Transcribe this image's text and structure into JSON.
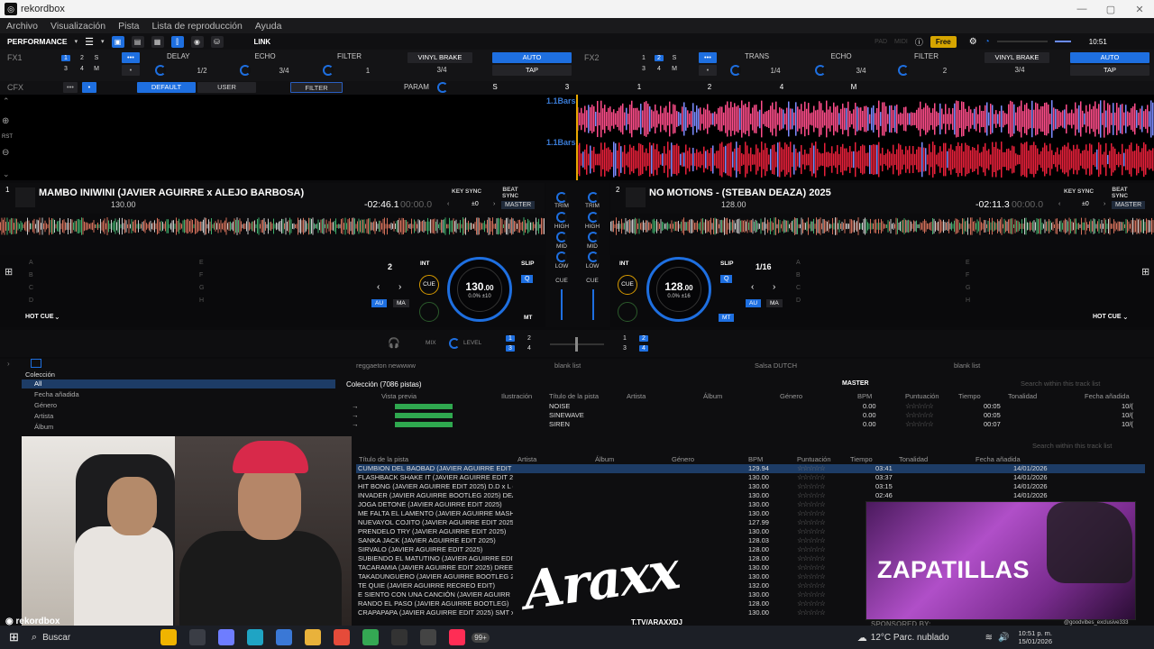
{
  "window": {
    "title": "rekordbox"
  },
  "menu": [
    "Archivo",
    "Visualización",
    "Pista",
    "Lista de reproducción",
    "Ayuda"
  ],
  "toolbar": {
    "mode": "PERFORMANCE",
    "link": "LINK",
    "pad": "PAD",
    "midi": "MIDI",
    "free": "Free",
    "clock": "10:51"
  },
  "fx1": {
    "label": "FX1",
    "slots": [
      "DELAY",
      "ECHO",
      "FILTER"
    ],
    "vinyl": "VINYL BRAKE",
    "auto": "AUTO",
    "tap": "TAP",
    "beats": [
      "1/2",
      "3/4",
      "1",
      "3/4"
    ]
  },
  "fx2": {
    "label": "FX2",
    "slots": [
      "TRANS",
      "ECHO",
      "FILTER"
    ],
    "vinyl": "VINYL BRAKE",
    "auto": "AUTO",
    "tap": "TAP",
    "beats": [
      "1/4",
      "3/4",
      "2",
      "3/4"
    ]
  },
  "cfx": {
    "label": "CFX",
    "default": "DEFAULT",
    "user": "USER",
    "filter": "FILTER",
    "param": "PARAM",
    "markers": [
      "S",
      "3",
      "1",
      "2",
      "4",
      "M"
    ]
  },
  "overview": {
    "bars_top": "1.1Bars",
    "bars_bottom": "1.1Bars",
    "rst": "RST"
  },
  "deck1": {
    "number": "1",
    "title": "MAMBO INIWINI (JAVIER AGUIRRE x ALEJO BARBOSA)",
    "bpm_small": "130.00",
    "key_sync": "KEY SYNC",
    "beat_sync": "BEAT SYNC",
    "time_remaining": "-02:46.1",
    "time_gray": "00:00.0",
    "key_offset": "±0",
    "master": "MASTER",
    "jog_bpm": "130",
    "jog_bpm_dec": ".00",
    "jog_pitch": "0.0% ±10",
    "loop": "2",
    "int": "INT",
    "slip": "SLIP",
    "q": "Q",
    "cue": "CUE",
    "au": "AU",
    "ma": "MA",
    "mt": "MT",
    "hot_cue": "HOT CUE",
    "pads": [
      "A",
      "B",
      "C",
      "D",
      "E",
      "F",
      "G",
      "H"
    ]
  },
  "deck2": {
    "number": "2",
    "title": "NO MOTIONS - (STEBAN DEAZA) 2025",
    "bpm_small": "128.00",
    "key_sync": "KEY SYNC",
    "beat_sync": "BEAT SYNC",
    "time_remaining": "-02:11.3",
    "time_gray": "00:00.0",
    "key_offset": "±0",
    "master": "MASTER",
    "jog_bpm": "128",
    "jog_bpm_dec": ".00",
    "jog_pitch": "0.0% ±16",
    "loop": "1/16",
    "int": "INT",
    "slip": "SLIP",
    "q": "Q",
    "cue": "CUE",
    "au": "AU",
    "ma": "MA",
    "mt": "MT",
    "hot_cue": "HOT CUE",
    "pads": [
      "A",
      "B",
      "C",
      "D",
      "E",
      "F",
      "G",
      "H"
    ]
  },
  "mixer": {
    "trim": "TRIM",
    "high": "HIGH",
    "mid": "MID",
    "low": "LOW",
    "cue": "CUE",
    "mix": "MIX",
    "level": "LEVEL"
  },
  "browser": {
    "tree": [
      "Colección",
      "All",
      "Fecha añadida",
      "Género",
      "Artista",
      "Álbum"
    ],
    "tabs": [
      "reggaeton newwww",
      "blank list",
      "Salsa DUTCH",
      "blank list"
    ],
    "collection_count": "Colección (7086 pistas)",
    "master": "MASTER",
    "search_placeholder": "Search within this track list",
    "upper_headers": [
      "Vista previa",
      "Ilustración",
      "Título de la pista",
      "Artista",
      "Álbum",
      "Género",
      "BPM",
      "Puntuación",
      "Tiempo",
      "Tonalidad",
      "Fecha añadida"
    ],
    "upper_rows": [
      {
        "title": "NOISE",
        "bpm": "0.00",
        "time": "00:05",
        "date": "10/("
      },
      {
        "title": "SINEWAVE",
        "bpm": "0.00",
        "time": "00:05",
        "date": "10/("
      },
      {
        "title": "SIREN",
        "bpm": "0.00",
        "time": "00:07",
        "date": "10/("
      }
    ],
    "lower_headers": [
      "Título de la pista",
      "Artista",
      "Álbum",
      "Género",
      "BPM",
      "Puntuación",
      "Tiempo",
      "Tonalidad",
      "Fecha añadida"
    ],
    "lower_rows": [
      {
        "title": "CUMBION DEL BAOBAD (JAVIER AGUIRRE EDIT 2",
        "bpm": "129.94",
        "time": "03:41",
        "date": "14/01/2026"
      },
      {
        "title": "FLASHBACK SHAKE IT (JAVIER AGUIRRE EDIT 20",
        "bpm": "130.00",
        "time": "03:37",
        "date": "14/01/2026"
      },
      {
        "title": "HIT BONG (JAVIER AGUIRRE EDIT 2025) D.D x L (",
        "bpm": "130.00",
        "time": "03:15",
        "date": "14/01/2026"
      },
      {
        "title": "INVADER (JAVIER AGUIRRE BOOTLEG 2025) DEA",
        "bpm": "130.00",
        "time": "02:46",
        "date": "14/01/2026"
      },
      {
        "title": "JOGA DETONE (JAVIER AGUIRRE EDIT 2025)",
        "bpm": "130.00",
        "time": "",
        "date": ""
      },
      {
        "title": "ME FALTA EL LAMENTO (JAVIER AGUIRRE MASH",
        "bpm": "130.00",
        "time": "",
        "date": ""
      },
      {
        "title": "NUEVAYOL COJITO (JAVIER AGUIRRE EDIT 2025)",
        "bpm": "127.99",
        "time": "",
        "date": ""
      },
      {
        "title": "PRENDELO TRY (JAVIER AGUIRRE EDIT 2025)",
        "bpm": "130.00",
        "time": "",
        "date": ""
      },
      {
        "title": "SANKA JACK (JAVIER AGUIRRE EDIT 2025)",
        "bpm": "128.03",
        "time": "",
        "date": ""
      },
      {
        "title": "SIRVALO (JAVIER AGUIRRE EDIT 2025)",
        "bpm": "128.00",
        "time": "",
        "date": ""
      },
      {
        "title": "SUBIENDO EL MATUTINO (JAVIER AGUIRRE EDIT",
        "bpm": "128.00",
        "time": "",
        "date": ""
      },
      {
        "title": "TACARAMIA (JAVIER AGUIRRE EDIT 2025) DREE",
        "bpm": "130.00",
        "time": "",
        "date": ""
      },
      {
        "title": "TAKADUNGUERO (JAVIER AGUIRRE BOOTLEG 2",
        "bpm": "130.00",
        "time": "",
        "date": ""
      },
      {
        "title": "TE QUIE (JAVIER AGUIRRE RECREO EDIT)",
        "bpm": "132.00",
        "time": "",
        "date": ""
      },
      {
        "title": "E SIENTO CON UNA CANCIÓN (JAVIER AGUIRR",
        "bpm": "130.00",
        "time": "",
        "date": ""
      },
      {
        "title": "RANDO EL PASO (JAVIER AGUIRRE BOOTLEG)",
        "bpm": "128.00",
        "time": "",
        "date": ""
      },
      {
        "title": "CRAPAPAPA (JAVIER AGUIRRE EDIT 2025) SMT x",
        "bpm": "130.00",
        "time": "",
        "date": ""
      }
    ]
  },
  "overlays": {
    "promo": "ZAPATILLAS",
    "sponsored": "SPONSORED BY:",
    "promo_handle": "@goodvibes_exclusive333",
    "brand": "Araxx",
    "ttv": "T.TV/ARAXXDJ",
    "rekordbox_watermark": "rekordbox"
  },
  "taskbar": {
    "search": "Buscar",
    "badge": "99+",
    "weather": "12°C  Parc. nublado",
    "time": "10:51 p. m.",
    "date": "15/01/2026"
  },
  "colors": {
    "accent": "#1e6fe0",
    "wave_pink": "#ff4d8a",
    "wave_red": "#e8203a",
    "cue_orange": "#d79a00"
  }
}
